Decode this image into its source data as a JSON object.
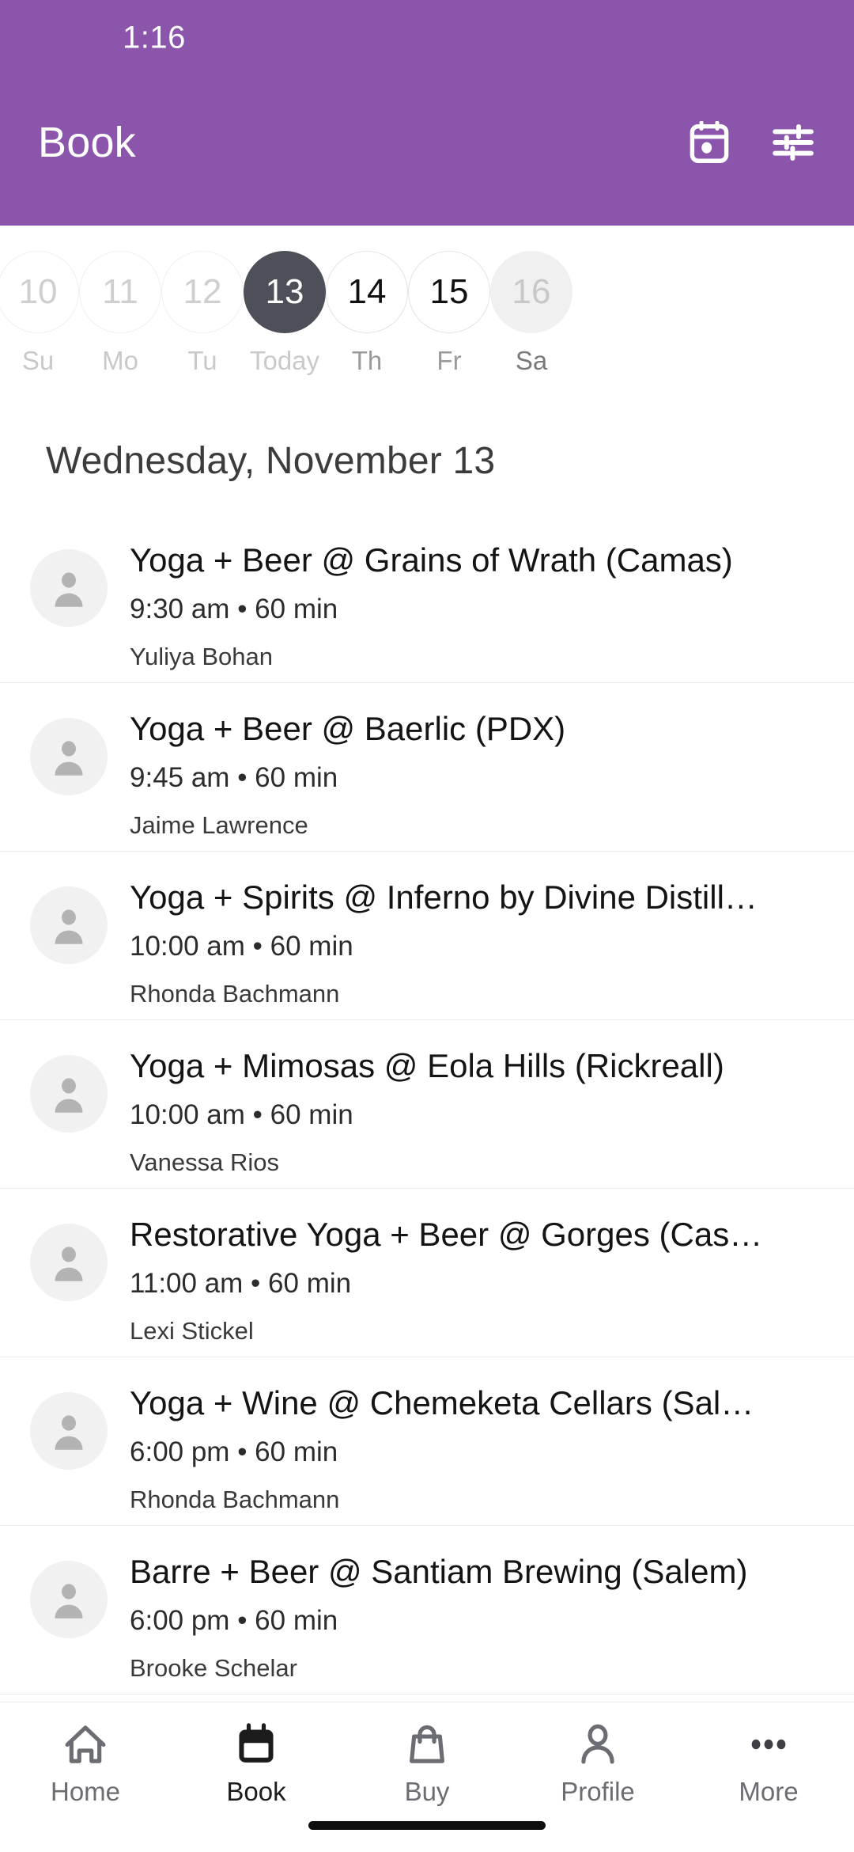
{
  "status_bar": {
    "time": "1:16"
  },
  "header": {
    "title": "Book",
    "calendar_icon": "calendar-today-icon",
    "filter_icon": "tune-filter-icon",
    "background_color": "#8B55AC"
  },
  "date_strip": {
    "selected_color": "#4D5059",
    "days": [
      {
        "number": "10",
        "weekday": "Su",
        "state": "past"
      },
      {
        "number": "11",
        "weekday": "Mo",
        "state": "past"
      },
      {
        "number": "12",
        "weekday": "Tu",
        "state": "past"
      },
      {
        "number": "13",
        "weekday": "Today",
        "state": "selected"
      },
      {
        "number": "14",
        "weekday": "Th",
        "state": "available"
      },
      {
        "number": "15",
        "weekday": "Fr",
        "state": "available"
      },
      {
        "number": "16",
        "weekday": "Sa",
        "state": "muted"
      }
    ]
  },
  "date_heading": "Wednesday, November 13",
  "classes": [
    {
      "title": "Yoga + Beer @ Grains of Wrath (Camas)",
      "meta": "9:30 am • 60 min",
      "instructor": "Yuliya Bohan",
      "avatar": "person-placeholder-icon"
    },
    {
      "title": "Yoga + Beer @ Baerlic (PDX)",
      "meta": "9:45 am • 60 min",
      "instructor": "Jaime Lawrence",
      "avatar": "person-placeholder-icon"
    },
    {
      "title": "Yoga + Spirits @ Inferno by Divine Distill…",
      "meta": "10:00 am • 60 min",
      "instructor": "Rhonda Bachmann",
      "avatar": "person-placeholder-icon"
    },
    {
      "title": "Yoga + Mimosas @ Eola Hills (Rickreall)",
      "meta": "10:00 am • 60 min",
      "instructor": "Vanessa Rios",
      "avatar": "person-placeholder-icon"
    },
    {
      "title": "Restorative Yoga + Beer @ Gorges (Cas…",
      "meta": "11:00 am • 60 min",
      "instructor": "Lexi Stickel",
      "avatar": "person-placeholder-icon"
    },
    {
      "title": "Yoga + Wine @ Chemeketa Cellars (Sal…",
      "meta": "6:00 pm • 60 min",
      "instructor": "Rhonda Bachmann",
      "avatar": "person-placeholder-icon"
    },
    {
      "title": "Barre + Beer @ Santiam Brewing (Salem)",
      "meta": "6:00 pm • 60 min",
      "instructor": "Brooke Schelar",
      "avatar": "person-placeholder-icon"
    }
  ],
  "bottom_nav": {
    "active": "Book",
    "items": [
      {
        "label": "Home",
        "icon": "home-icon"
      },
      {
        "label": "Book",
        "icon": "calendar-filled-icon"
      },
      {
        "label": "Buy",
        "icon": "shopping-bag-icon"
      },
      {
        "label": "Profile",
        "icon": "person-icon"
      },
      {
        "label": "More",
        "icon": "more-horizontal-icon"
      }
    ]
  }
}
